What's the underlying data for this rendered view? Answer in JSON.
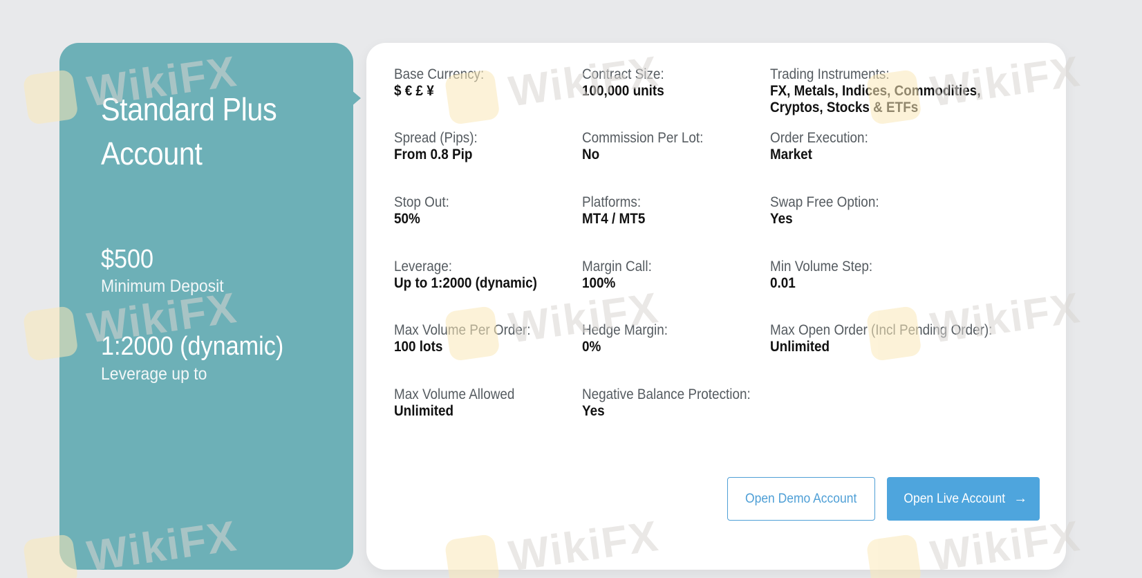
{
  "account": {
    "title": "Standard Plus Account",
    "deposit_amount": "$500",
    "deposit_caption": "Minimum Deposit",
    "leverage_amount": "1:2000 (dynamic)",
    "leverage_caption": "Leverage up to"
  },
  "specs": {
    "base_currency": {
      "label": "Base Currency:",
      "value": "$ € £ ¥"
    },
    "contract_size": {
      "label": "Contract Size:",
      "value": "100,000 units"
    },
    "trading_instruments": {
      "label": "Trading Instruments:",
      "value": "FX, Metals, Indices, Commodities, Cryptos, Stocks & ETFs"
    },
    "spread": {
      "label": "Spread (Pips):",
      "value": "From 0.8 Pip"
    },
    "commission": {
      "label": "Commission Per Lot:",
      "value": "No"
    },
    "order_execution": {
      "label": "Order Execution:",
      "value": "Market"
    },
    "stop_out": {
      "label": "Stop Out:",
      "value": "50%"
    },
    "platforms": {
      "label": "Platforms:",
      "value": "MT4 / MT5"
    },
    "swap_free": {
      "label": "Swap Free Option:",
      "value": "Yes"
    },
    "leverage": {
      "label": "Leverage:",
      "value": "Up to 1:2000 (dynamic)"
    },
    "margin_call": {
      "label": "Margin Call:",
      "value": "100%"
    },
    "min_volume_step": {
      "label": "Min Volume Step:",
      "value": "0.01"
    },
    "max_volume_per_order": {
      "label": "Max Volume Per Order:",
      "value": "100 lots"
    },
    "hedge_margin": {
      "label": "Hedge Margin:",
      "value": "0%"
    },
    "max_open_order": {
      "label": "Max Open Order (Incl Pending Order):",
      "value": "Unlimited"
    },
    "max_volume_allowed": {
      "label": "Max Volume Allowed",
      "value": "Unlimited"
    },
    "negative_balance": {
      "label": "Negative Balance Protection:",
      "value": "Yes"
    }
  },
  "actions": {
    "demo_label": "Open Demo Account",
    "live_label": "Open Live Account",
    "live_icon": "arrow-right-icon",
    "live_arrow": "→"
  },
  "watermark": {
    "text": "WikiFX"
  },
  "colors": {
    "panel": "#6db0b7",
    "button_primary": "#4ea5dd",
    "button_outline": "#4e9fd6",
    "background": "#e8e9eb"
  }
}
